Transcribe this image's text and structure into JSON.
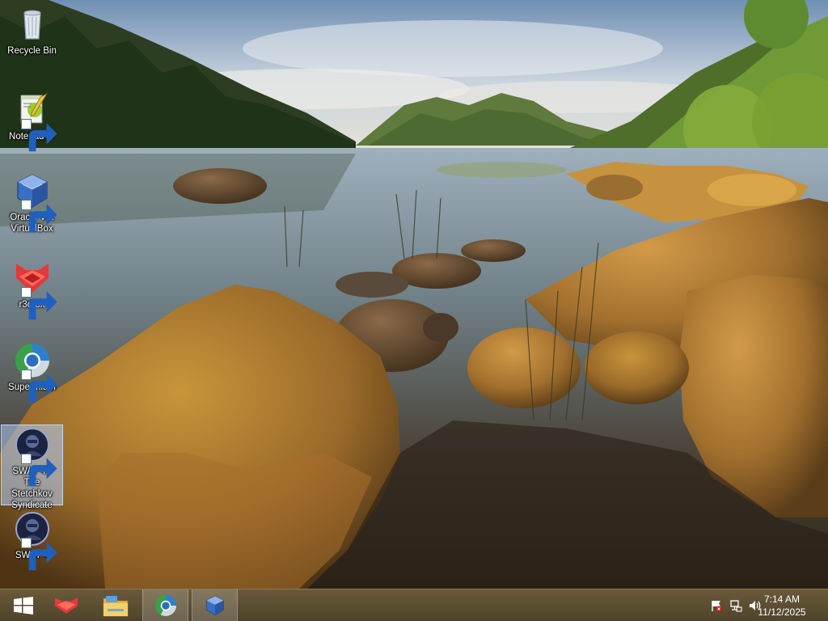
{
  "desktop": {
    "icons": [
      {
        "label": "Recycle Bin",
        "icon": "recycle-bin-icon"
      },
      {
        "label": "Notepad++",
        "icon": "notepad-plus-plus-icon"
      },
      {
        "label": "Oracle VM VirtualBox",
        "icon": "virtualbox-icon"
      },
      {
        "label": "r3dfox",
        "icon": "r3dfox-icon"
      },
      {
        "label": "Supermium",
        "icon": "supermium-icon"
      },
      {
        "label": "SWAT 4 - The Stetchkov Syndicate",
        "icon": "swat4-icon",
        "selected": true
      },
      {
        "label": "SWAT 4",
        "icon": "swat4-icon"
      }
    ]
  },
  "taskbar": {
    "items": [
      {
        "name": "start-button",
        "icon": "windows-logo-icon"
      },
      {
        "name": "r3dfox",
        "icon": "r3dfox-icon"
      },
      {
        "name": "file-explorer",
        "icon": "folder-icon"
      },
      {
        "name": "supermium",
        "icon": "supermium-icon",
        "active": true
      },
      {
        "name": "virtualbox",
        "icon": "virtualbox-icon",
        "active": true
      }
    ],
    "tray": {
      "icons": [
        "action-center-flag-icon",
        "network-icon",
        "volume-icon"
      ],
      "time": "7:14 AM",
      "date": "11/12/2025"
    }
  },
  "colors": {
    "taskbar": "#5a4c32",
    "selection": "#add0ff"
  }
}
